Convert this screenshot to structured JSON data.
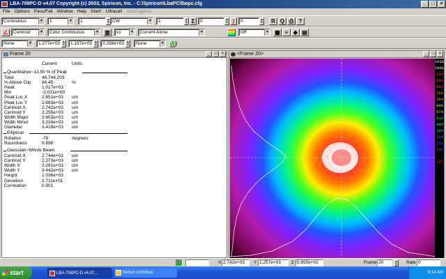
{
  "window": {
    "title": "LBA-708PC-D     v4.07     Copyright (c) 2003, Spiricon, Inc. - C:\\Spiricon\\LbaPC\\lbapc.cfg"
  },
  "menu": {
    "items": [
      "File",
      "Options",
      "Pass/Fail",
      "Window",
      "Help",
      "Start!",
      "Ultracal!"
    ],
    "disabled_item": "autoCapture"
  },
  "toolbar1": {
    "mode": "Continuous",
    "field2": "1",
    "field3": "1",
    "source": "CW",
    "field5": "1",
    "sum_value": "0",
    "field7": "0"
  },
  "toolbar2": {
    "centroid": "Centroid",
    "palette": "Color Continuous",
    "zoom": "x1",
    "display": "Current Alone",
    "field5": "Off"
  },
  "toolbar3": {
    "field1": "None",
    "value1": "1.277e+03",
    "value2": "1.197e+03",
    "value3": "3.298e+03",
    "field5": "None"
  },
  "left_panel": {
    "title": "Frame 20",
    "col_current": "Current",
    "col_units": "Units",
    "sec_quant": "Quantitative~13.50 % of Peak",
    "sec_ellip": "Elliptical",
    "sec_gauss": "Gaussian~Whole Beam",
    "rows_quant": [
      {
        "label": "Total",
        "value": "46,744,203",
        "unit": ""
      },
      {
        "label": "% Above Clip",
        "value": "86.45",
        "unit": "%"
      },
      {
        "label": "Peak",
        "value": "1.017e+03",
        "unit": ""
      },
      {
        "label": "Min",
        "value": "-3.031e+00",
        "unit": ""
      },
      {
        "label": "Peak Loc X",
        "value": "2.851e+03",
        "unit": "um"
      },
      {
        "label": "Peak Loc Y",
        "value": "2.683e+03",
        "unit": "um"
      },
      {
        "label": "Centroid X",
        "value": "2.742e+03",
        "unit": "um"
      },
      {
        "label": "Centroid Y",
        "value": "2.255e+03",
        "unit": "um"
      },
      {
        "label": "Width Major",
        "value": "3.602e+03",
        "unit": "um"
      },
      {
        "label": "Width Minor",
        "value": "3.234e+03",
        "unit": "um"
      },
      {
        "label": "Diameter",
        "value": "3.418e+03",
        "unit": "um"
      }
    ],
    "rows_ellip": [
      {
        "label": "Rotation",
        "value": "-76",
        "unit": "degrees"
      },
      {
        "label": "Roundness",
        "value": "0.898",
        "unit": ""
      }
    ],
    "rows_gauss": [
      {
        "label": "Centroid X",
        "value": "2.744e+03",
        "unit": "um"
      },
      {
        "label": "Centroid Y",
        "value": "2.273e+03",
        "unit": "um"
      },
      {
        "label": "Width X",
        "value": "3.261e+03",
        "unit": "um"
      },
      {
        "label": "Width Y",
        "value": "3.442e+03",
        "unit": "um"
      },
      {
        "label": "Height",
        "value": "1.036e+03",
        "unit": ""
      },
      {
        "label": "Deviation",
        "value": "2.711e+01",
        "unit": ""
      },
      {
        "label": "Correlation",
        "value": "0.901",
        "unit": ""
      }
    ]
  },
  "right_panel": {
    "title": "<Frame 20>",
    "legend": [
      {
        "value": "1016",
        "color": "#ffffff"
      },
      {
        "value": "1001",
        "color": "#ffffff"
      },
      {
        "value": "960",
        "color": "#ff3333"
      },
      {
        "value": "896",
        "color": "#ff4422"
      },
      {
        "value": "832",
        "color": "#ff6622"
      },
      {
        "value": "768",
        "color": "#ff9900"
      },
      {
        "value": "704",
        "color": "#ffbb00"
      },
      {
        "value": "640",
        "color": "#ffff00"
      },
      {
        "value": "576",
        "color": "#aaff00"
      },
      {
        "value": "512",
        "color": "#33ff33"
      },
      {
        "value": "448",
        "color": "#00ffaa"
      },
      {
        "value": "384",
        "color": "#00ccff"
      },
      {
        "value": "320",
        "color": "#3388ff"
      },
      {
        "value": "256",
        "color": "#3344ff"
      },
      {
        "value": "192",
        "color": "#8833ff"
      },
      {
        "value": "137",
        "color": "#ff2222"
      }
    ]
  },
  "statusbar": {
    "x_label": "X",
    "x_value": "2.742e+03",
    "y_label": "Y",
    "y_value": "2.257e+03",
    "z_label": "Z",
    "z_value": "5.650e+02",
    "frame_label": "Frame",
    "frame_value": "20",
    "rate_label": "Rate",
    "rate_value": "0"
  },
  "taskbar": {
    "start": "start",
    "item1": "LBA-708PC-D     v4.07...",
    "item2": "Norton AntiVirus",
    "clock": "9:14 AM"
  },
  "colors": {
    "titlebar": "#0a246a",
    "taskbar": "#1f55d8",
    "start": "#2e8b2e"
  }
}
